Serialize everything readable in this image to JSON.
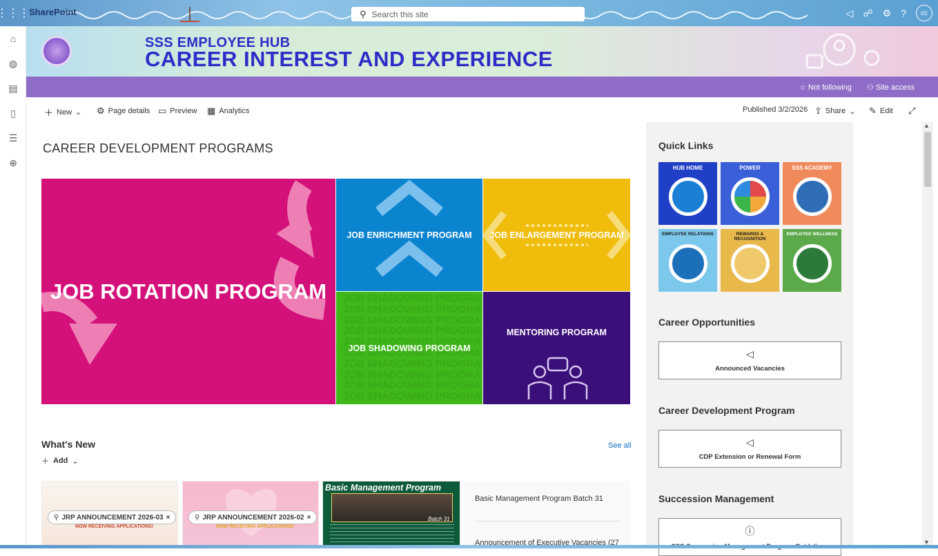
{
  "suite": {
    "brand": "SharePoint",
    "search_placeholder": "Search this site",
    "avatar_initials": "cc"
  },
  "header": {
    "title_small": "SSS EMPLOYEE HUB",
    "title_large": "CAREER INTEREST AND EXPERIENCE"
  },
  "site_actions": {
    "follow": "Not following",
    "access": "Site access"
  },
  "commands": {
    "new": "New",
    "page_details": "Page details",
    "preview": "Preview",
    "analytics": "Analytics",
    "published": "Published 3/2/2026",
    "share": "Share",
    "edit": "Edit"
  },
  "main": {
    "section_title": "CAREER DEVELOPMENT PROGRAMS",
    "tiles": {
      "rotation": "JOB ROTATION PROGRAM",
      "enrichment": "JOB ENRICHMENT PROGRAM",
      "enlargement": "JOB ENLARGEMENT PROGRAM",
      "shadowing": "JOB SHADOWING PROGRAM",
      "mentoring": "MENTORING PROGRAM"
    },
    "shadow_pattern_text": "JOB SHADOWING PROGRAM",
    "whats_new": {
      "title": "What's New",
      "add": "Add",
      "see_all": "See all",
      "card1": {
        "pill": "JRP ANNOUNCEMENT 2026-03",
        "sub": "NOW RECEIVING APPLICATIONS!"
      },
      "card2": {
        "pill": "JRP ANNOUNCEMENT 2026-02",
        "sub": "NOW RECEIVING APPLICATIONS!"
      },
      "card3": {
        "title": "Basic Management Program",
        "batch": "Batch 31"
      },
      "news": [
        "Basic Management Program Batch 31",
        "Announcement of Executive Vacancies (27"
      ]
    }
  },
  "right_pane": {
    "quick_links_title": "Quick Links",
    "quick_links": [
      {
        "label": "HUB HOME",
        "bg": "#1f3fc6",
        "ring": "#1c7fd6"
      },
      {
        "label": "POWER",
        "bg": "#3a5fd8",
        "ring": "#f2a73b"
      },
      {
        "label": "SSS ACADEMY",
        "bg": "#f08a5b",
        "ring": "#2f6db6"
      },
      {
        "label": "EMPLOYEE RELATIONS",
        "bg": "#7cc8ec",
        "ring": "#1c6fb9"
      },
      {
        "label": "REWARDS & RECOGNITION",
        "bg": "#e8b84a",
        "ring": "#e8b84a"
      },
      {
        "label": "EMPLOYEE WELLNESS",
        "bg": "#5ba94a",
        "ring": "#2b7a3a"
      }
    ],
    "career_opportunities": {
      "title": "Career Opportunities",
      "button": "Announced Vacancies"
    },
    "career_development": {
      "title": "Career Development Program",
      "button": "CDP Extension or Renewal Form"
    },
    "succession": {
      "title": "Succession Management",
      "button": "SSS Succession Management Program Guidelines"
    }
  }
}
